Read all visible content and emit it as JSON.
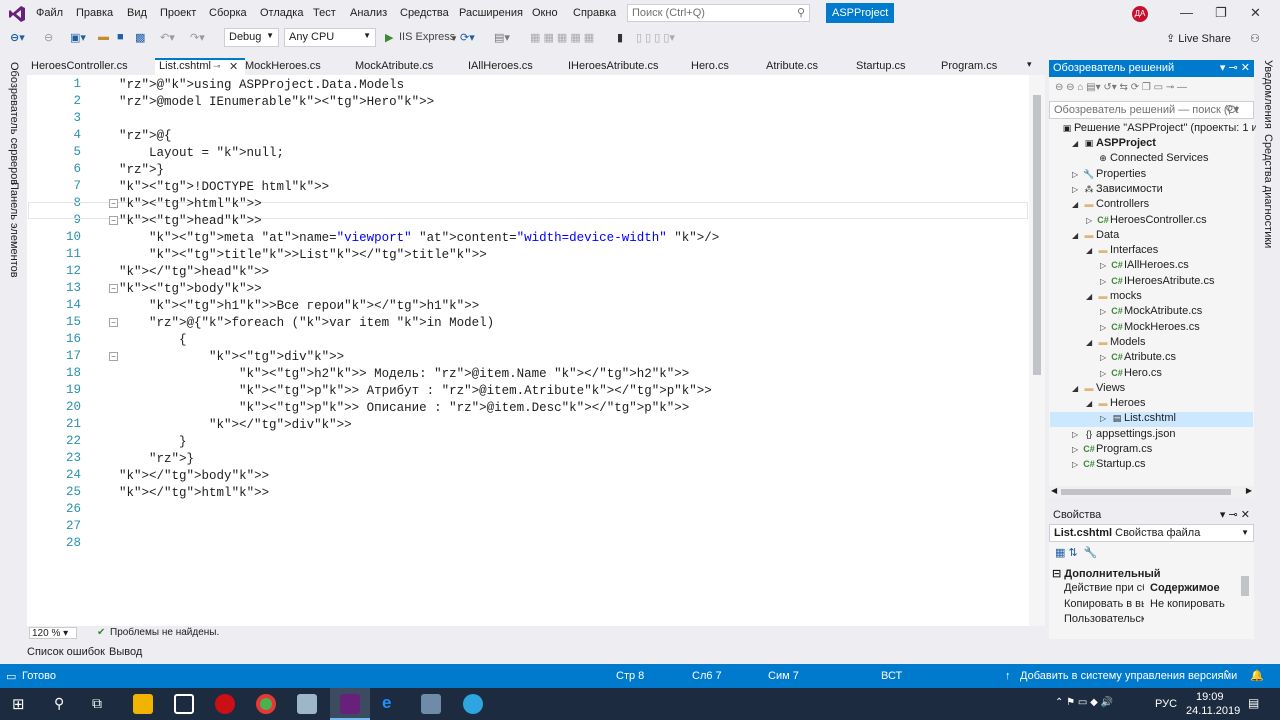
{
  "menu": {
    "items": [
      "Файл",
      "Правка",
      "Вид",
      "Проект",
      "Сборка",
      "Отладка",
      "Тест",
      "Анализ",
      "Средства",
      "Расширения",
      "Окно",
      "Справка"
    ],
    "search_placeholder": "Поиск (Ctrl+Q)",
    "project_name": "ASPProject",
    "user_initials": "ДА"
  },
  "toolbar": {
    "config": "Debug",
    "platform": "Any CPU",
    "run_label": "IIS Express",
    "live_share": "Live Share"
  },
  "left_tabs": [
    "Обозреватель серверов",
    "Панель элементов"
  ],
  "right_tabs": [
    "Уведомления",
    "Средства диагностики"
  ],
  "tabs": [
    "HeroesController.cs",
    "List.cshtml",
    "MockHeroes.cs",
    "MockAtribute.cs",
    "IAllHeroes.cs",
    "IHeroesAtribute.cs",
    "Hero.cs",
    "Atribute.cs",
    "Startup.cs",
    "Program.cs"
  ],
  "active_tab_index": 1,
  "code": {
    "line_numbers": [
      "1",
      "2",
      "3",
      "4",
      "5",
      "6",
      "7",
      "8",
      "9",
      "10",
      "11",
      "12",
      "13",
      "14",
      "15",
      "16",
      "17",
      "18",
      "19",
      "20",
      "21",
      "22",
      "23",
      "24",
      "25",
      "26",
      "27",
      "28"
    ],
    "lines": [
      "@using ASPProject.Data.Models",
      "@model IEnumerable<Hero>",
      "",
      "@{",
      "    Layout = null;",
      "}",
      "<!DOCTYPE html>",
      "<html>",
      "<head>",
      "    <meta name=\"viewport\" content=\"width=device-width\" />",
      "    <title>List</title>",
      "</head>",
      "<body>",
      "    <h1>Все герои</h1>",
      "    @{foreach (var item in Model)",
      "        {",
      "            <div>",
      "                <h2> Модель: @item.Name </h2>",
      "                <p> Атрибут : @item.Atribute</p>",
      "                <p> Описание : @item.Desc</p>",
      "            </div>",
      "        }",
      "    }",
      "</body>",
      "</html>",
      "",
      "",
      ""
    ]
  },
  "editor_status": {
    "zoom": "120 %",
    "issues": "Проблемы не найдены."
  },
  "solution_explorer": {
    "title": "Обозреватель решений",
    "search_placeholder": "Обозреватель решений — поиск (Ct",
    "solution_label": "Решение \"ASPProject\" (проекты: 1 из 1",
    "nodes": [
      {
        "label": "ASPProject",
        "bold": true
      },
      {
        "label": "Connected Services"
      },
      {
        "label": "Properties"
      },
      {
        "label": "Зависимости"
      },
      {
        "label": "Controllers"
      },
      {
        "label": "HeroesController.cs"
      },
      {
        "label": "Data"
      },
      {
        "label": "Interfaces"
      },
      {
        "label": "IAllHeroes.cs"
      },
      {
        "label": "IHeroesAtribute.cs"
      },
      {
        "label": "mocks"
      },
      {
        "label": "MockAtribute.cs"
      },
      {
        "label": "MockHeroes.cs"
      },
      {
        "label": "Models"
      },
      {
        "label": "Atribute.cs"
      },
      {
        "label": "Hero.cs"
      },
      {
        "label": "Views"
      },
      {
        "label": "Heroes"
      },
      {
        "label": "List.cshtml"
      },
      {
        "label": "appsettings.json"
      },
      {
        "label": "Program.cs"
      },
      {
        "label": "Startup.cs"
      }
    ]
  },
  "properties": {
    "title": "Свойства",
    "object": "List.cshtml",
    "object_type": "Свойства файла",
    "section": "Дополнительный",
    "rows": [
      {
        "name": "Действие при сбо",
        "value": "Содержимое"
      },
      {
        "name": "Копировать в вы",
        "value": "Не копировать"
      },
      {
        "name": "Пользовательски",
        "value": ""
      }
    ]
  },
  "bottom_tabs": [
    "Список ошибок",
    "Вывод"
  ],
  "status": {
    "ready": "Готово",
    "line": "Стр 8",
    "col": "Сл6 7",
    "ch": "Сим 7",
    "mode": "ВСТ",
    "vcs": "Добавить в систему управления версиями"
  },
  "taskbar": {
    "lang": "РУС",
    "time": "19:09",
    "date": "24.11.2019"
  }
}
